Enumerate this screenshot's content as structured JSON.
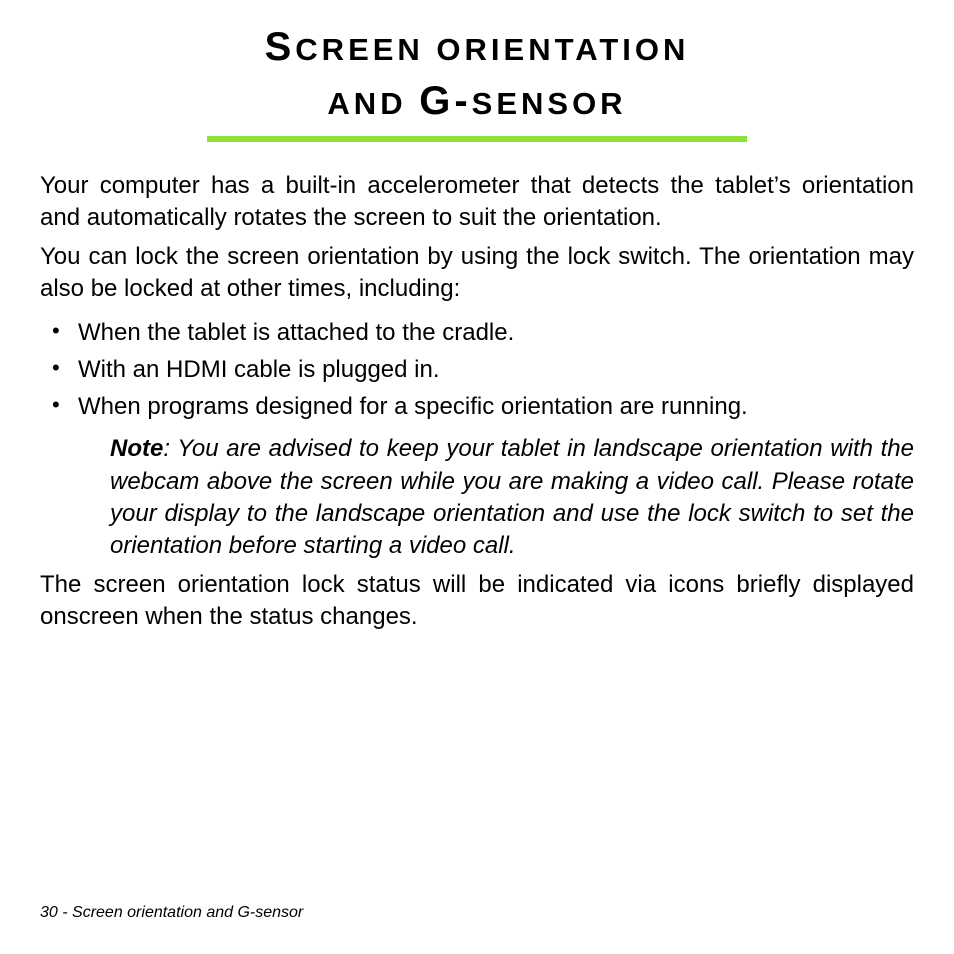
{
  "title": {
    "line1_cap": "S",
    "line1_rest": "CREEN ORIENTATION",
    "line2_prefix": "AND ",
    "line2_cap": "G",
    "line2_dash": "-",
    "line2_rest": "SENSOR"
  },
  "paragraphs": {
    "p1": "Your computer has a built-in accelerometer that detects the tablet’s orientation and automatically rotates the screen to suit the orientation.",
    "p2": "You can lock the screen orientation by using the lock switch. The orientation may also be locked at other times, including:",
    "p3": "The screen orientation lock status will be indicated via icons briefly displayed onscreen when the status changes."
  },
  "bullets": [
    "When the tablet is attached to the cradle.",
    "With an HDMI cable is plugged in.",
    "When programs designed for a specific orientation are running."
  ],
  "note": {
    "label": "Note",
    "text": ": You are advised to keep your tablet in landscape orientation with the webcam above the screen while you are making a video call. Please rotate your display to the landscape orientation and use the lock switch to set the orientation before starting a video call."
  },
  "footer": {
    "page_number": "30",
    "separator": " - ",
    "section": "Screen orientation and G-sensor"
  }
}
